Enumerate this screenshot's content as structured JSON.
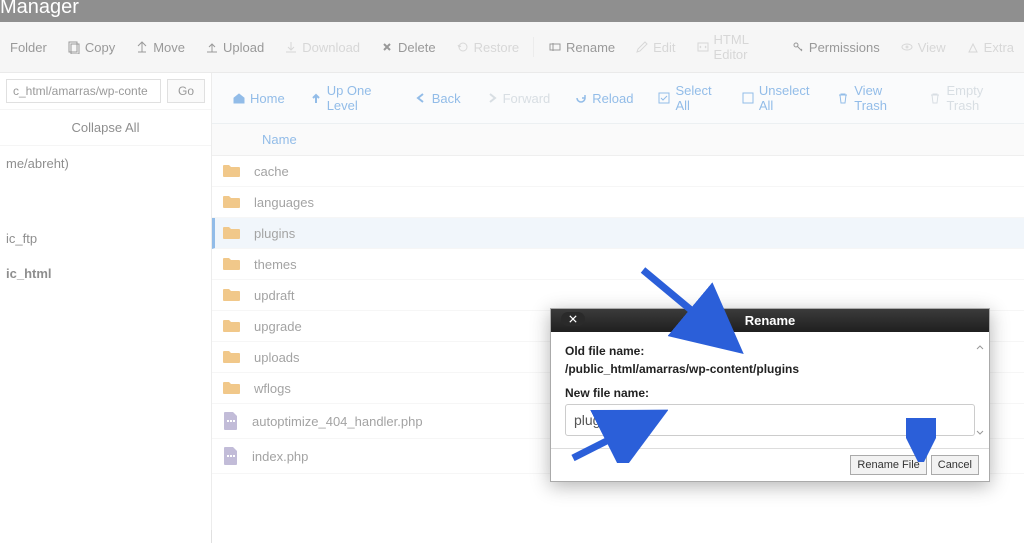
{
  "app_title": "Manager",
  "toolbar": {
    "folder": "Folder",
    "copy": "Copy",
    "move": "Move",
    "upload": "Upload",
    "download": "Download",
    "delete": "Delete",
    "restore": "Restore",
    "rename": "Rename",
    "edit": "Edit",
    "html_editor": "HTML Editor",
    "permissions": "Permissions",
    "view": "View",
    "extract": "Extra"
  },
  "sidebar": {
    "path_value": "c_html/amarras/wp-conte",
    "go_label": "Go",
    "collapse_all": "Collapse All",
    "tree": [
      "me/abreht)",
      "ic_ftp",
      "ic_html"
    ]
  },
  "sub_toolbar": {
    "home": "Home",
    "up": "Up One Level",
    "back": "Back",
    "forward": "Forward",
    "reload": "Reload",
    "select_all": "Select All",
    "unselect_all": "Unselect All",
    "view_trash": "View Trash",
    "empty_trash": "Empty Trash"
  },
  "table": {
    "name_col": "Name"
  },
  "rows": [
    {
      "name": "cache",
      "type": "folder"
    },
    {
      "name": "languages",
      "type": "folder"
    },
    {
      "name": "plugins",
      "type": "folder",
      "selected": true
    },
    {
      "name": "themes",
      "type": "folder"
    },
    {
      "name": "updraft",
      "type": "folder"
    },
    {
      "name": "upgrade",
      "type": "folder"
    },
    {
      "name": "uploads",
      "type": "folder"
    },
    {
      "name": "wflogs",
      "type": "folder"
    },
    {
      "name": "autoptimize_404_handler.php",
      "type": "php"
    },
    {
      "name": "index.php",
      "type": "php"
    }
  ],
  "modal": {
    "title": "Rename",
    "old_label": "Old file name:",
    "old_path": "/public_html/amarras/wp-content/plugins",
    "new_label": "New file name:",
    "new_value": "plugins_BK",
    "rename_btn": "Rename File",
    "cancel_btn": "Cancel"
  }
}
